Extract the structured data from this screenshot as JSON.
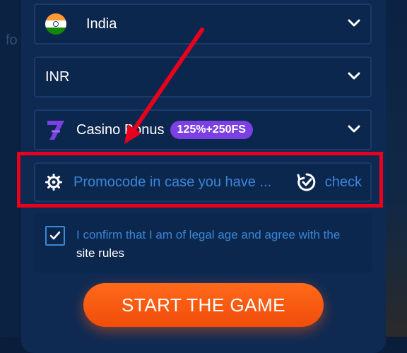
{
  "background": {
    "partial_text": "fo"
  },
  "country": {
    "label": "India",
    "flag_icon": "india-flag-icon"
  },
  "currency": {
    "label": "INR"
  },
  "bonus": {
    "label": "Casino Bonus",
    "badge": "125%+250FS",
    "badge_color": "#7b3fe4",
    "icon": "casino-seven-icon"
  },
  "promo": {
    "placeholder": "Promocode in case you have ...",
    "check_label": "check",
    "gear_icon": "gear-icon",
    "check_icon": "refresh-check-icon"
  },
  "confirm": {
    "checked": true,
    "text_part1": "I confirm that I am of legal age and agree with the",
    "text_part2": "site rules"
  },
  "start_button": {
    "label": "START THE GAME",
    "color": "#ff6a1a"
  },
  "annotation": {
    "highlight_color": "#e8001c"
  }
}
